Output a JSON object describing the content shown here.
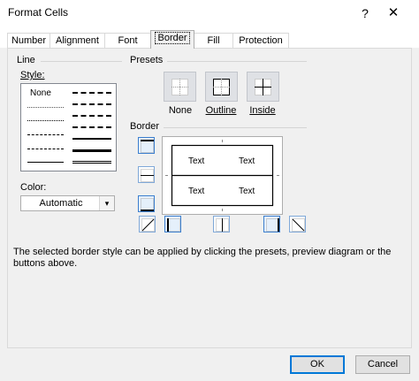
{
  "window": {
    "title": "Format Cells",
    "help_glyph": "?",
    "close_glyph": "✕"
  },
  "tabs": [
    {
      "label": "Number"
    },
    {
      "label": "Alignment"
    },
    {
      "label": "Font"
    },
    {
      "label": "Border",
      "active": true
    },
    {
      "label": "Fill"
    },
    {
      "label": "Protection"
    }
  ],
  "line": {
    "group_label": "Line",
    "style_label": "Style:",
    "style_none": "None",
    "color_label": "Color:",
    "color_value": "Automatic",
    "color_arrow": "▾"
  },
  "presets": {
    "group_label": "Presets",
    "items": [
      {
        "label": "None"
      },
      {
        "label": "Outline"
      },
      {
        "label": "Inside"
      }
    ]
  },
  "border": {
    "group_label": "Border",
    "preview_text": [
      "Text",
      "Text",
      "Text",
      "Text"
    ]
  },
  "description": "The selected border style can be applied by clicking the presets, preview diagram or the buttons above.",
  "buttons": {
    "ok": "OK",
    "cancel": "Cancel"
  },
  "colors": {
    "accent": "#0078d7",
    "button_border": "#7fa8d8",
    "panel_bg": "#f0f0f0"
  }
}
